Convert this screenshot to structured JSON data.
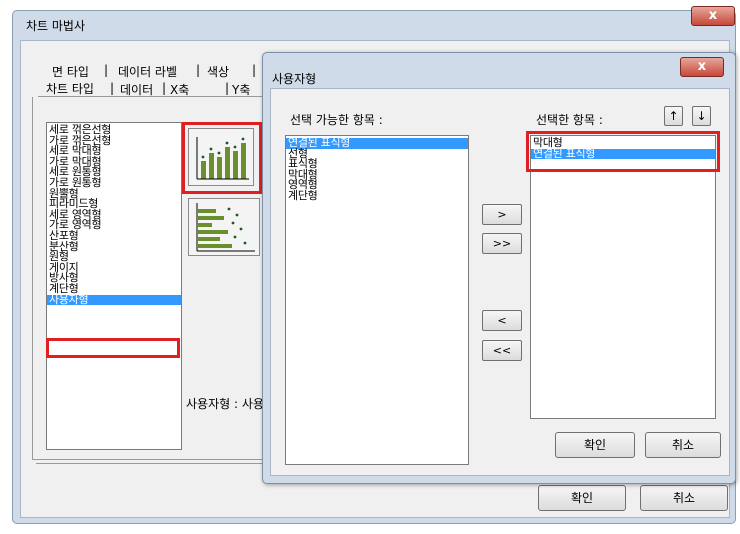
{
  "wizard": {
    "title": "차트 마법사",
    "close_glyph": "x",
    "tabs_row1": [
      "면 타입",
      "데이터 라벨",
      "색상"
    ],
    "tabs_row2": [
      "차트 타입",
      "데이터",
      "X축",
      "Y축"
    ],
    "separator": "|",
    "chart_types": [
      "세로 꺾은선형",
      "가로 꺾은선형",
      "세로 막대형",
      "가로 막대형",
      "세로 원통형",
      "가로 원통형",
      "원뿔형",
      "피라미드형",
      "세로 영역형",
      "가로 영역형",
      "산포형",
      "분산형",
      "원형",
      "게이지",
      "방사형",
      "계단형",
      "사용자형"
    ],
    "selected_type": "사용자형",
    "description": "사용자형 : 사용",
    "ok_label": "확인",
    "cancel_label": "취소",
    "icons": [
      "bar-line-chart-icon",
      "horizontal-bar-scatter-icon"
    ]
  },
  "custom_dialog": {
    "title": "사용자형",
    "close_glyph": "x",
    "available_label": "선택 가능한 항목 :",
    "selected_label": "선택한 항목 :",
    "available_items": [
      "연결된 표식형",
      "선형",
      "표식형",
      "막대형",
      "영역형",
      "계단형"
    ],
    "available_highlighted": "연결된 표식형",
    "selected_items": [
      "막대형",
      "연결된 표식형"
    ],
    "selected_highlighted": "연결된 표식형",
    "move_right": ">",
    "move_all_right": ">>",
    "move_left": "<",
    "move_all_left": "<<",
    "up_arrow": "↑",
    "down_arrow": "↓",
    "ok_label": "확인",
    "cancel_label": "취소"
  },
  "colors": {
    "highlight": "#3399ff",
    "annotation_red": "#e02020",
    "titlebar": "#cfdbe9"
  }
}
